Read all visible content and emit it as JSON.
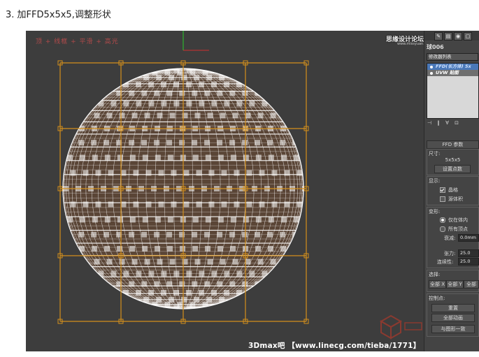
{
  "title": "3. 加FFD5x5x5,调整形状",
  "viewport": {
    "label": "顶 + 线框 + 平滑 + 高光",
    "background": "#3d3d3d",
    "ffd_color": "#d4901c",
    "mesh_color": "#ffffff"
  },
  "watermark": {
    "site": "思缘设计论坛",
    "site_url": "www.missyuan.com",
    "footer": "3Dmax吧 【www.linecg.com/tieba/1771】"
  },
  "panel": {
    "object_name": "球006",
    "modifier_list_label": "修改器列表",
    "stack": [
      {
        "label": "FFD(长方体) 5x",
        "selected": true
      },
      {
        "label": "UVW 贴图",
        "selected": false
      }
    ],
    "rollout_title": "FFD 参数",
    "dimensions": {
      "group": "尺寸:",
      "value": "5x5x5",
      "set_points": "设置点数"
    },
    "display": {
      "group": "显示:",
      "lattice": "晶格",
      "source_volume": "源体积"
    },
    "deform": {
      "group": "变形:",
      "only_in_volume": "仅在体内",
      "all_vertices": "所有顶点",
      "falloff_label": "衰减:",
      "falloff_value": "0.0mm",
      "tension_label": "张力:",
      "tension_value": "25.0",
      "continuity_label": "连续性:",
      "continuity_value": "25.0"
    },
    "selection": {
      "group": "选择:",
      "all_x": "全部 X",
      "all_y": "全部 Y",
      "all_z": "全部"
    },
    "control_points": {
      "group": "控制点:",
      "reset": "重置",
      "animate_all": "全部动画",
      "conform": "与图形一致"
    }
  }
}
